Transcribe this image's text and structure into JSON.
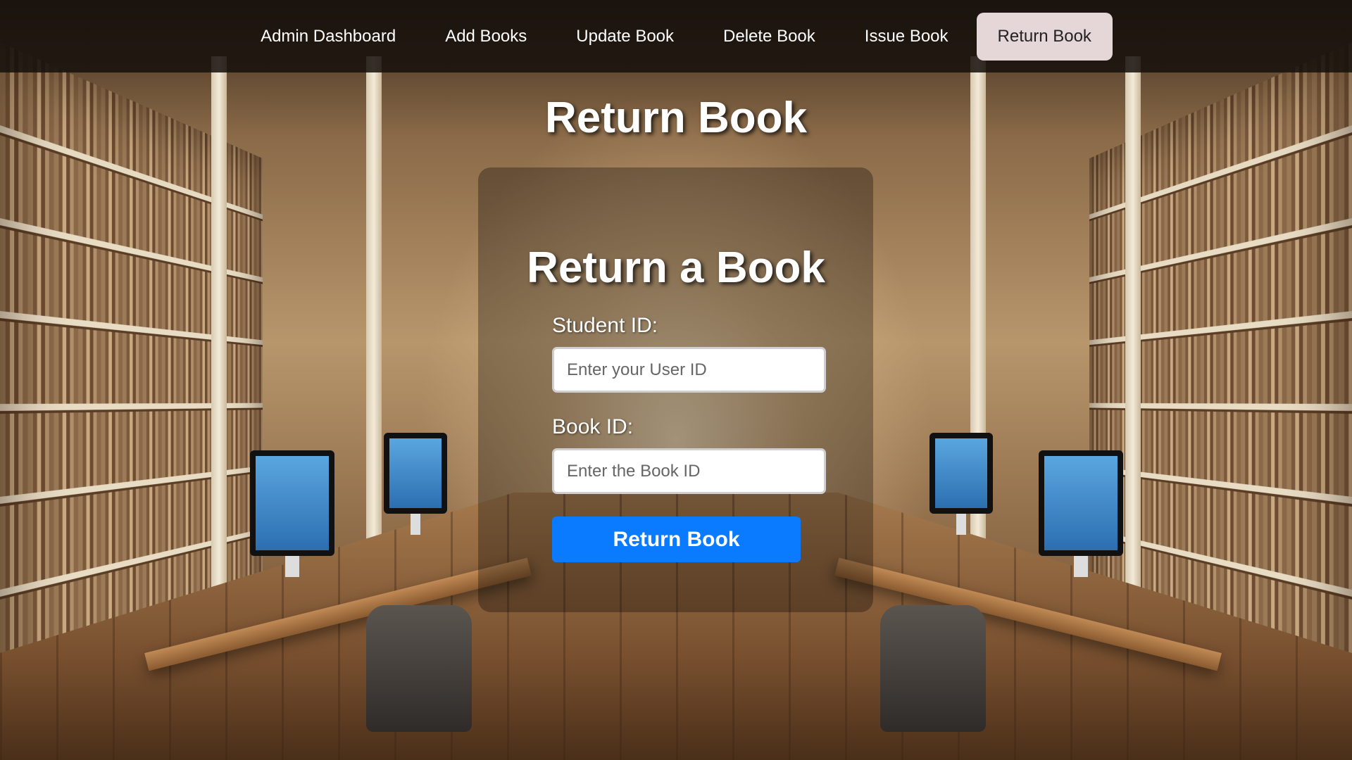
{
  "nav": {
    "items": [
      {
        "label": "Admin Dashboard",
        "active": false
      },
      {
        "label": "Add Books",
        "active": false
      },
      {
        "label": "Update Book",
        "active": false
      },
      {
        "label": "Delete Book",
        "active": false
      },
      {
        "label": "Issue Book",
        "active": false
      },
      {
        "label": "Return Book",
        "active": true
      }
    ]
  },
  "main": {
    "page_title": "Return Book",
    "form_title": "Return a Book",
    "student_id_label": "Student ID:",
    "student_id_placeholder": "Enter your User ID",
    "student_id_value": "",
    "book_id_label": "Book ID:",
    "book_id_placeholder": "Enter the Book ID",
    "book_id_value": "",
    "submit_label": "Return Book"
  },
  "colors": {
    "nav_bg": "#16100c",
    "active_tab_bg": "#e5d6d8",
    "submit_button": "#0a7bff"
  }
}
